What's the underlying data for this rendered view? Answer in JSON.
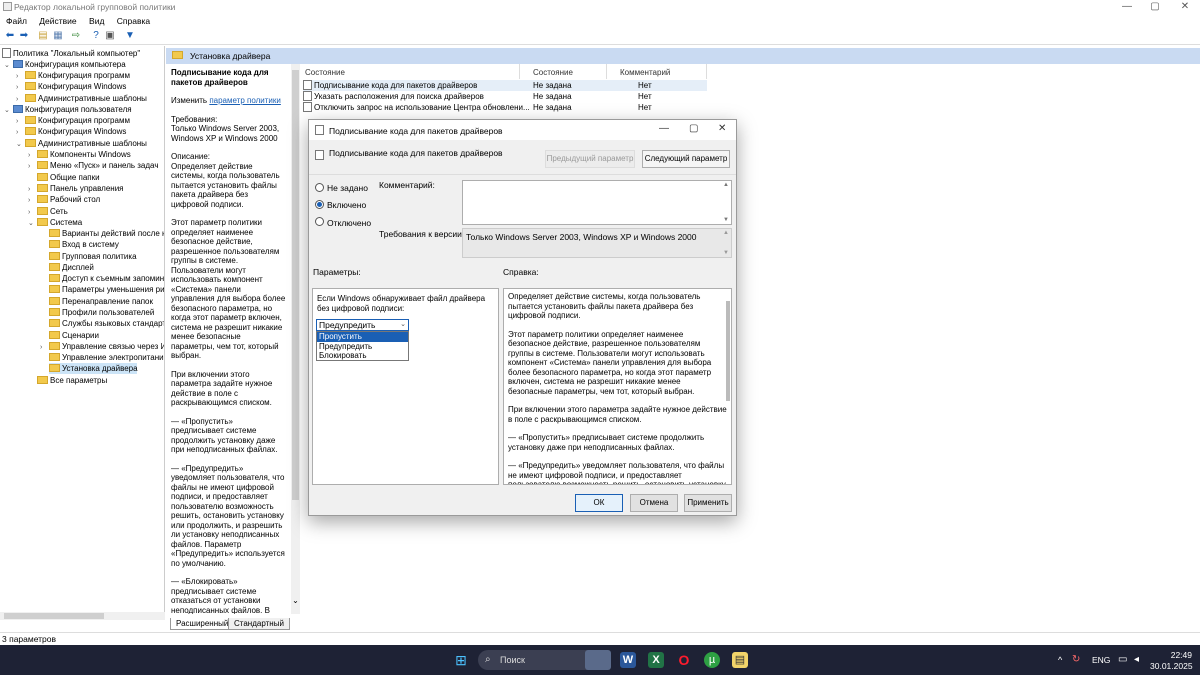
{
  "window": {
    "title": "Редактор локальной групповой политики",
    "minimize": "—",
    "maximize": "▢",
    "close": "✕"
  },
  "menu": [
    "Файл",
    "Действие",
    "Вид",
    "Справка"
  ],
  "tree": {
    "root": "Политика \"Локальный компьютер\"",
    "computer": "Конфигурация компьютера",
    "c_programs": "Конфигурация программ",
    "c_windows": "Конфигурация Windows",
    "c_admin": "Административные шаблоны",
    "user": "Конфигурация пользователя",
    "u_programs": "Конфигурация программ",
    "u_windows": "Конфигурация Windows",
    "u_admin": "Административные шаблоны",
    "components": "Компоненты Windows",
    "startmenu": "Меню «Пуск» и панель задач",
    "shared": "Общие папки",
    "controlpanel": "Панель управления",
    "desktop": "Рабочий стол",
    "network": "Сеть",
    "system": "Система",
    "sys_items": [
      "Варианты действий после на",
      "Вход в систему",
      "Групповая политика",
      "Дисплей",
      "Доступ к съемным запомина",
      "Параметры уменьшения рис",
      "Перенаправление папок",
      "Профили пользователей",
      "Службы языковых стандарт",
      "Сценарии",
      "Управление связью через И",
      "Управление электропитание",
      "Установка драйвера"
    ],
    "all": "Все параметры"
  },
  "detail_header": "Установка драйвера",
  "desc": {
    "title": "Подписывание кода для пакетов драйверов",
    "edit_prefix": "Изменить ",
    "edit_link": "параметр политики",
    "req_label": "Требования:",
    "req_text": "Только Windows Server 2003, Windows XP и Windows 2000",
    "desc_label": "Описание:",
    "desc_text": "Определяет действие системы, когда пользователь пытается установить файлы пакета драйвера без цифровой подписи.",
    "p2": "Этот параметр политики определяет наименее безопасное действие, разрешенное пользователям группы в системе. Пользователи могут использовать компонент «Система» панели управления для выбора более безопасного параметра, но когда этот параметр включен, система не разрешит никакие менее безопасные параметры, чем тот, который выбран.",
    "p3": "При включении этого параметра задайте нужное действие в поле с раскрывающимся списком.",
    "p4": "— «Пропустить» предписывает системе продолжить установку даже при неподписанных файлах.",
    "p5": "— «Предупредить» уведомляет пользователя, что файлы не имеют цифровой подписи, и предоставляет пользователю возможность решить, остановить установку или продолжить, и разрешить ли установку неподписанных файлов. Параметр «Предупредить» используется по умолчанию.",
    "p6": "— «Блокировать» предписывает системе отказаться от установки неподписанных файлов. В результате установка прекращается и никакие файлы из пакета драйвера не устанавливаются."
  },
  "list": {
    "headers": [
      "Состояние",
      "Состояние",
      "Комментарий"
    ],
    "rows": [
      {
        "name": "Подписывание кода для пакетов драйверов",
        "state": "Не задана",
        "comment": "Нет"
      },
      {
        "name": "Указать расположения для поиска драйверов",
        "state": "Не задана",
        "comment": "Нет"
      },
      {
        "name": "Отключить запрос на использование Центра обновлени...",
        "state": "Не задана",
        "comment": "Нет"
      }
    ]
  },
  "tabs": [
    "Расширенный",
    "Стандартный"
  ],
  "status": "3 параметров",
  "dialog": {
    "title": "Подписывание кода для пакетов драйверов",
    "subtitle": "Подписывание кода для пакетов драйверов",
    "prev": "Предыдущий параметр",
    "next": "Следующий параметр",
    "radios": [
      "Не задано",
      "Включено",
      "Отключено"
    ],
    "selected_radio": 1,
    "comment_label": "Комментарий:",
    "req_label": "Требования к версии:",
    "req_value": "Только Windows Server 2003, Windows XP и Windows 2000",
    "params_label": "Параметры:",
    "help_label": "Справка:",
    "dd_label": "Если Windows обнаруживает файл драйвера без цифровой подписи:",
    "dd_value": "Предупредить",
    "dd_options": [
      "Пропустить",
      "Предупредить",
      "Блокировать"
    ],
    "dd_highlight": 0,
    "help_p1": "Определяет действие системы, когда пользователь пытается установить файлы пакета драйвера без цифровой подписи.",
    "help_p2": "Этот параметр политики определяет наименее безопасное действие, разрешенное пользователям группы в системе. Пользователи могут использовать компонент «Система» панели управления для выбора более безопасного параметра, но когда этот параметр включен, система не разрешит никакие менее безопасные параметры, чем тот, который выбран.",
    "help_p3": "При включении этого параметра задайте нужное действие в поле с раскрывающимся списком.",
    "help_p4": "— «Пропустить» предписывает системе продолжить установку даже при неподписанных файлах.",
    "help_p5": "— «Предупредить» уведомляет пользователя, что файлы не имеют цифровой подписи, и предоставляет пользователю возможность решить, остановить установку или продолжить, и разрешить ли установку неподписанных файлов.",
    "ok": "ОК",
    "cancel": "Отмена",
    "apply": "Применить"
  },
  "taskbar": {
    "search": "Поиск",
    "lang": "ENG",
    "time": "22:49",
    "date": "30.01.2025"
  },
  "colors": {
    "accent": "#1a5fb4",
    "selection": "#cce4f7",
    "header": "#c9daf2",
    "taskbar": "#1e2235"
  }
}
